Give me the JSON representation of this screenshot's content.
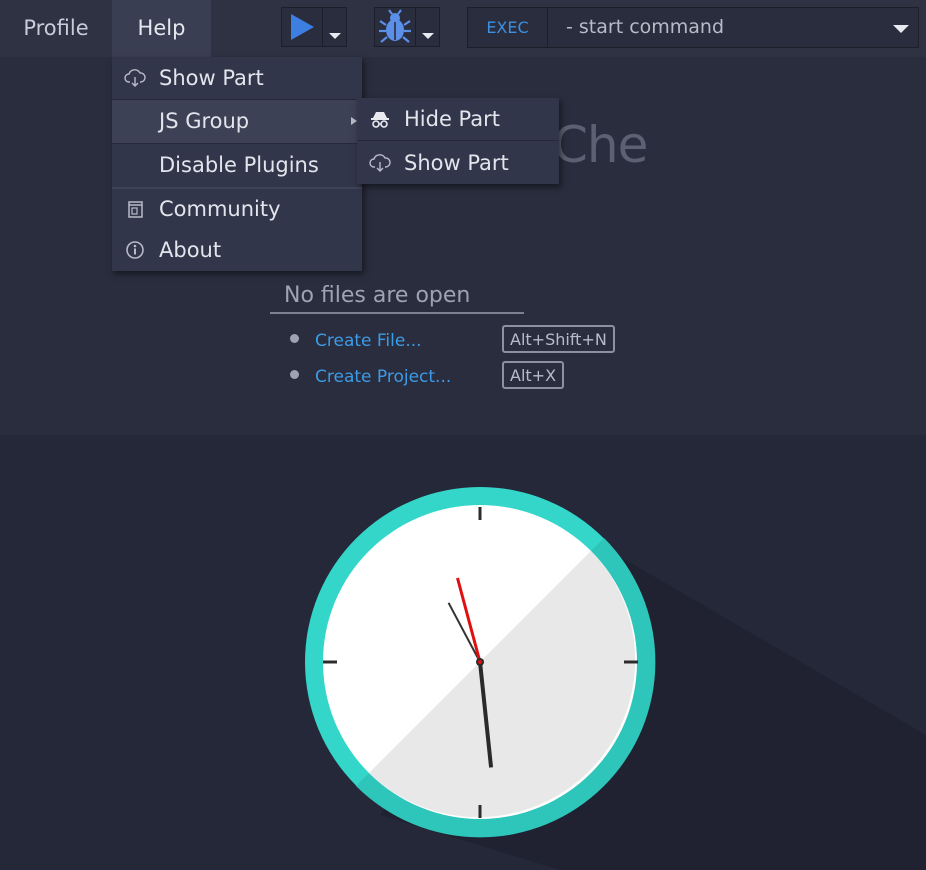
{
  "menubar": {
    "profile": "Profile",
    "help": "Help"
  },
  "toolbar": {
    "run_icon": "play-icon",
    "debug_icon": "bug-icon",
    "exec_label": "EXEC",
    "command_placeholder": "- start command"
  },
  "help_menu": {
    "items": [
      {
        "label": "Show Part",
        "icon": "cloud-download-icon"
      },
      {
        "label": "JS Group",
        "icon": "",
        "has_submenu": true
      },
      {
        "label": "Disable Plugins",
        "icon": ""
      },
      {
        "label": "Community",
        "icon": "community-icon"
      },
      {
        "label": "About",
        "icon": "info-icon"
      }
    ]
  },
  "submenu": {
    "items": [
      {
        "label": "Hide Part",
        "icon": "incognito-icon"
      },
      {
        "label": "Show Part",
        "icon": "cloud-download-icon"
      }
    ]
  },
  "logo_text": "Che",
  "empty_state": {
    "title": "No files are open",
    "actions": [
      {
        "label": "Create File...",
        "shortcut": "Alt+Shift+N"
      },
      {
        "label": "Create Project...",
        "shortcut": "Alt+X"
      }
    ]
  },
  "clock": {
    "hour_hand_angle_deg": -28,
    "minute_hand_angle_deg": 174,
    "second_hand_angle_deg": -15,
    "ring_color": "#33d6c9",
    "face_color": "#ffffff",
    "second_hand_color": "#e01010"
  },
  "colors": {
    "link": "#3c9be6",
    "exec_accent": "#3d8fe0",
    "play_icon": "#3d7fe0",
    "bug_icon": "#5b8fe8"
  }
}
